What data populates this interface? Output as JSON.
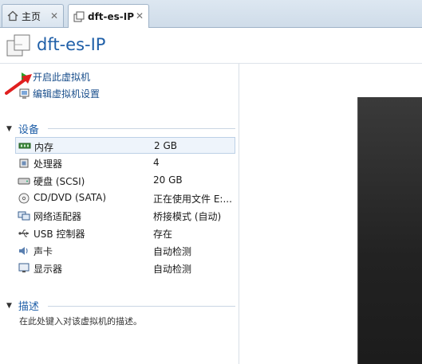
{
  "tabs": [
    {
      "label": "主页",
      "icon": "home-icon"
    },
    {
      "label": "dft-es-IP",
      "icon": "vm-icon"
    }
  ],
  "header": {
    "title": "dft-es-IP"
  },
  "actions": [
    {
      "label": "开启此虚拟机",
      "icon": "play-icon"
    },
    {
      "label": "编辑虚拟机设置",
      "icon": "edit-settings-icon"
    }
  ],
  "devices": {
    "section_title": "设备",
    "items": [
      {
        "name": "内存",
        "value": "2 GB",
        "icon": "memory-icon"
      },
      {
        "name": "处理器",
        "value": "4",
        "icon": "cpu-icon"
      },
      {
        "name": "硬盘 (SCSI)",
        "value": "20 GB",
        "icon": "hard-disk-icon"
      },
      {
        "name": "CD/DVD (SATA)",
        "value": "正在使用文件 E:...",
        "icon": "cd-dvd-icon"
      },
      {
        "name": "网络适配器",
        "value": "桥接模式 (自动)",
        "icon": "network-adapter-icon"
      },
      {
        "name": "USB 控制器",
        "value": "存在",
        "icon": "usb-icon"
      },
      {
        "name": "声卡",
        "value": "自动检测",
        "icon": "sound-card-icon"
      },
      {
        "name": "显示器",
        "value": "自动检测",
        "icon": "display-icon"
      }
    ]
  },
  "description": {
    "section_title": "描述",
    "placeholder": "在此处键入对该虚拟机的描述。"
  },
  "colors": {
    "accent": "#1f5fa8",
    "play": "#2aa02a",
    "annotation_arrow": "#e02020"
  }
}
